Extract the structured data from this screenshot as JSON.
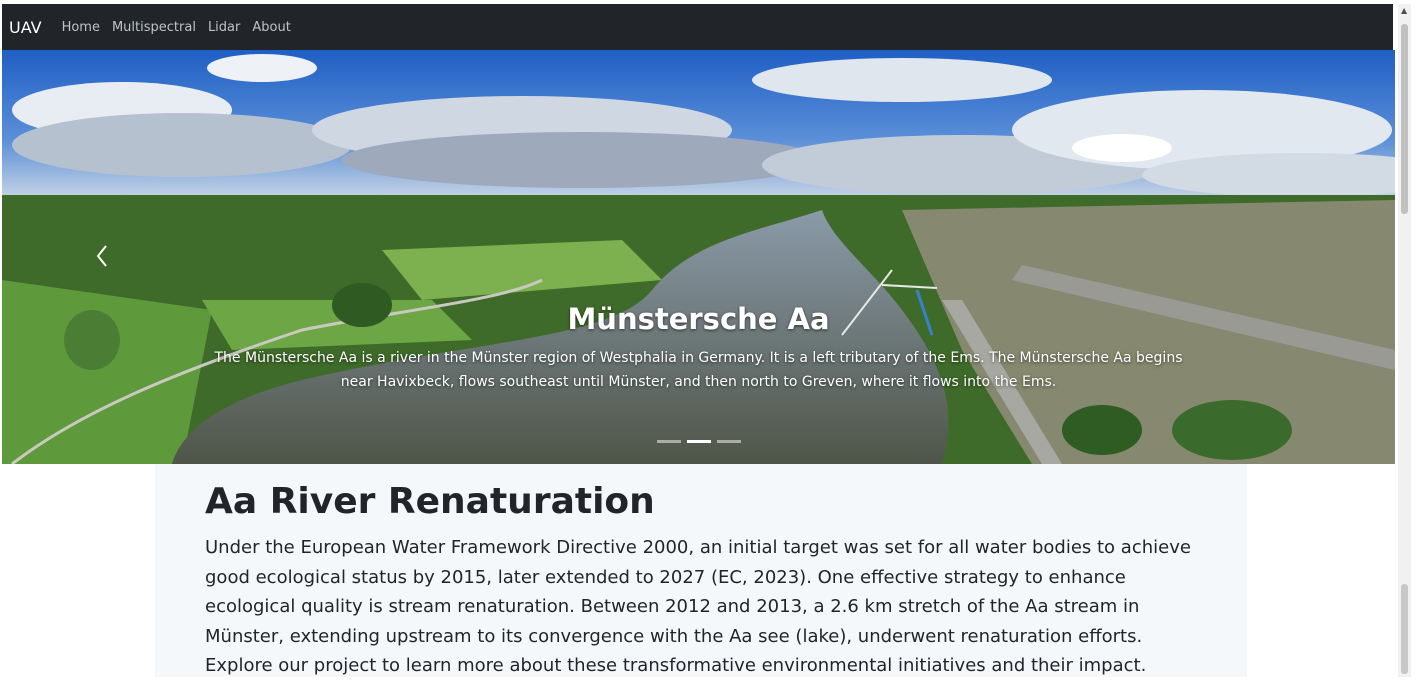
{
  "navbar": {
    "brand": "UAV",
    "links": [
      "Home",
      "Multispectral",
      "Lidar",
      "About"
    ]
  },
  "carousel": {
    "image_description_icon": "aerial-river-photo",
    "caption_title": "Münstersche Aa",
    "caption_text": "The Münstersche Aa is a river in the Münster region of Westphalia in Germany. It is a left tributary of the Ems. The Münstersche Aa begins near Havixbeck, flows southeast until Münster, and then north to Greven, where it flows into the Ems.",
    "slide_count": 3,
    "active_slide": 2
  },
  "main": {
    "heading": "Aa River Renaturation",
    "body": "Under the European Water Framework Directive 2000, an initial target was set for all water bodies to achieve good ecological status by 2015, later extended to 2027 (EC, 2023). One effective strategy to enhance ecological quality is stream renaturation. Between 2012 and 2013, a 2.6 km stretch of the Aa stream in Münster, extending upstream to its convergence with the Aa see (lake), underwent renaturation efforts. Explore our project to learn more about these transformative environmental initiatives and their impact."
  },
  "colors": {
    "navbar_bg": "#212529",
    "content_bg": "#f5f8fb",
    "text": "#212529"
  }
}
